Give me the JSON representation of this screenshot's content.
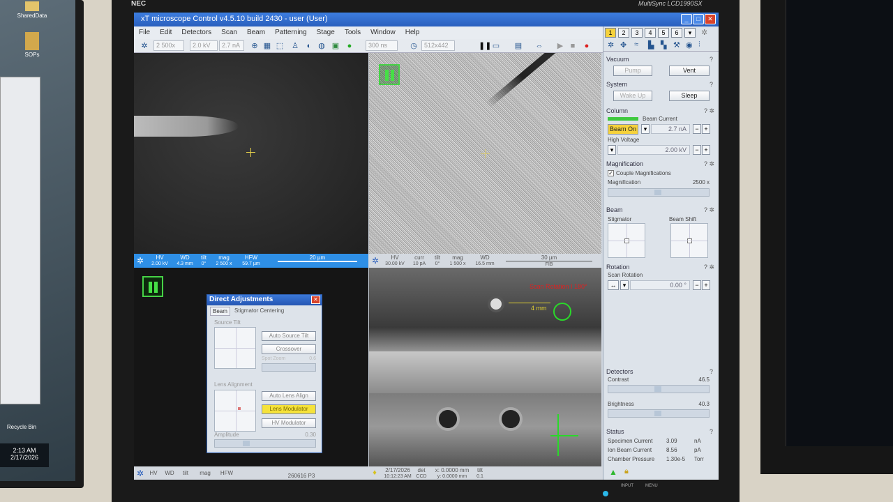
{
  "desktop": {
    "icons": [
      "SharedData",
      "SOPs",
      "Recycle Bin"
    ],
    "clock_time": "2:13 AM",
    "clock_date": "2/17/2026"
  },
  "monitor": {
    "brand": "NEC",
    "model": "MultiSync LCD1990SX",
    "buttons": [
      "INPUT",
      "MENU"
    ]
  },
  "app": {
    "title": "xT microscope Control v4.5.10 build 2430 - user (User)"
  },
  "menu": [
    "File",
    "Edit",
    "Detectors",
    "Scan",
    "Beam",
    "Patterning",
    "Stage",
    "Tools",
    "Window",
    "Help"
  ],
  "toolbar": {
    "mag": "2 500x",
    "hv": "2.0 kV",
    "current": "2.7 nA",
    "dwell": "300 ns",
    "resolution": "512x442"
  },
  "quads": {
    "q1": {
      "bar": [
        {
          "label": "HV",
          "value": "2.00 kV"
        },
        {
          "label": "WD",
          "value": "4.3 mm"
        },
        {
          "label": "tilt",
          "value": "0°"
        },
        {
          "label": "mag",
          "value": "2 500 x"
        },
        {
          "label": "HFW",
          "value": "59.7 µm"
        }
      ],
      "scale": "20 µm"
    },
    "q2": {
      "bar": [
        {
          "label": "HV",
          "value": "30.00 kV"
        },
        {
          "label": "curr",
          "value": "10 pA"
        },
        {
          "label": "tilt",
          "value": "0°"
        },
        {
          "label": "mag",
          "value": "1 500 x"
        },
        {
          "label": "WD",
          "value": "16.5 mm"
        }
      ],
      "scale": "30 µm",
      "detector": "FIB"
    },
    "q4": {
      "overlay_rotation": "Scan Rotation I 180°",
      "overlay_distance": "4 mm"
    },
    "bottom_bar": {
      "labels": [
        "HV",
        "WD",
        "tilt",
        "mag",
        "HFW"
      ],
      "center": "260616 P3",
      "date": "2/17/2026",
      "time": "10:12:23 AM",
      "det": "det",
      "det_val": "CCD",
      "x": "x: 0.0000 mm",
      "y": "y: 0.0000 mm",
      "tilt": "tilt",
      "tilt_val": "0.1"
    }
  },
  "panel": {
    "pages": [
      "1",
      "2",
      "3",
      "4",
      "5",
      "6"
    ],
    "vacuum": {
      "title": "Vacuum",
      "pump": "Pump",
      "vent": "Vent"
    },
    "system": {
      "title": "System",
      "wake": "Wake Up",
      "sleep": "Sleep"
    },
    "column": {
      "title": "Column",
      "beam_on": "Beam On",
      "beam_current_label": "Beam Current",
      "beam_current": "2.7 nA",
      "hv_label": "High Voltage",
      "hv": "2.00 kV"
    },
    "magnification": {
      "title": "Magnification",
      "couple": "Couple Magnifications",
      "label": "Magnification",
      "value": "2500 x"
    },
    "beam": {
      "title": "Beam",
      "stigmator": "Stigmator",
      "shift": "Beam Shift"
    },
    "rotation": {
      "title": "Rotation",
      "label": "Scan Rotation",
      "value": "0.00 °"
    },
    "detectors": {
      "title": "Detectors",
      "contrast_label": "Contrast",
      "contrast": "46.5",
      "brightness_label": "Brightness",
      "brightness": "40.3"
    },
    "status": {
      "title": "Status",
      "rows": [
        {
          "label": "Specimen Current",
          "value": "3.09",
          "unit": "nA"
        },
        {
          "label": "Ion Beam Current",
          "value": "8.56",
          "unit": "pA"
        },
        {
          "label": "Chamber Pressure",
          "value": "1.30e-5",
          "unit": "Torr"
        }
      ]
    }
  },
  "dialog": {
    "title": "Direct Adjustments",
    "tabs": [
      "Beam",
      "Stigmator Centering"
    ],
    "source_tilt": "Source Tilt",
    "auto_source_tilt": "Auto Source Tilt",
    "crossover": "Crossover",
    "spot_zoom": "Spot Zoom",
    "spot_zoom_value": "0.6",
    "lens_alignment": "Lens Alignment",
    "auto_lens_align": "Auto Lens Align",
    "lens_modulator": "Lens Modulator",
    "hv_modulator": "HV Modulator",
    "amplitude": "Amplitude",
    "amplitude_value": "0.30"
  }
}
